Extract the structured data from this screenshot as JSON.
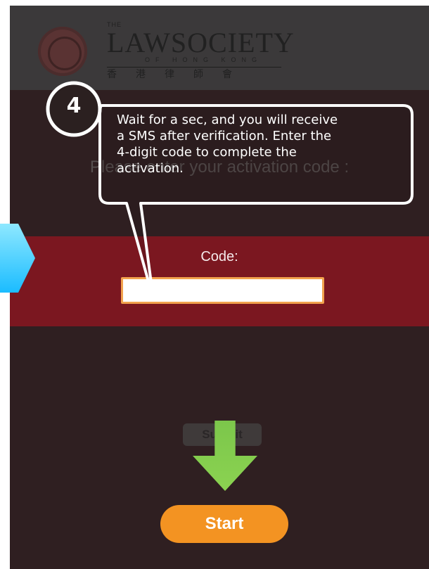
{
  "header": {
    "logo": {
      "the": "THE",
      "main": "LAWSOCIETY",
      "sub": "OF HONG KONG",
      "chinese": "香港律師會"
    }
  },
  "activation": {
    "prompt": "Please enter your activation code :",
    "code_label": "Code:",
    "code_value": "",
    "code_placeholder": "",
    "submit_label": "Submit"
  },
  "tutorial": {
    "step_number": "4",
    "instruction_lines": [
      "Wait for a sec, and you will receive",
      "a SMS after verification. Enter the",
      "4-digit code to complete the",
      "activation."
    ]
  },
  "footer": {
    "start_label": "Start"
  },
  "colors": {
    "background": "#2f1f21",
    "header": "#3b393a",
    "band": "#7b1720",
    "input_border": "#f2a24d",
    "start_button": "#f39322",
    "callout_stroke": "#ffffff",
    "blue_arrow": "#1bbcff",
    "green_arrow": "#7cc64b"
  },
  "icons": {
    "seal": "law-society-seal-icon",
    "blue_arrow": "blue-right-arrow-icon",
    "green_arrow": "green-down-arrow-icon"
  }
}
